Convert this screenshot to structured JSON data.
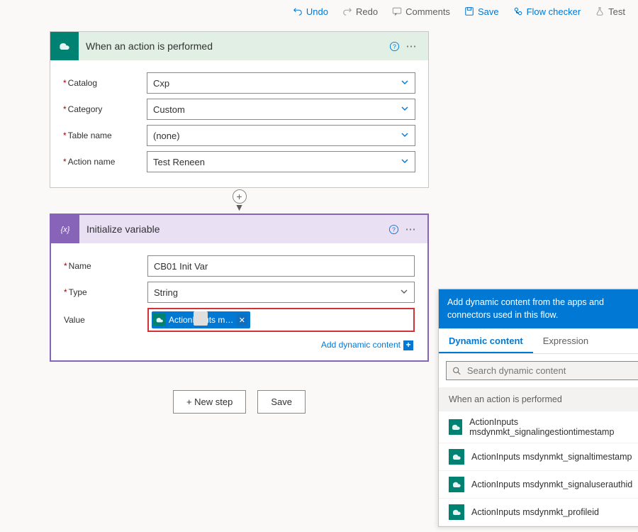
{
  "toolbar": {
    "undo": "Undo",
    "redo": "Redo",
    "comments": "Comments",
    "save": "Save",
    "flowchecker": "Flow checker",
    "test": "Test"
  },
  "card1": {
    "title": "When an action is performed",
    "fields": {
      "catalog": {
        "label": "Catalog",
        "value": "Cxp"
      },
      "category": {
        "label": "Category",
        "value": "Custom"
      },
      "tablename": {
        "label": "Table name",
        "value": "(none)"
      },
      "actionname": {
        "label": "Action name",
        "value": "Test Reneen"
      }
    }
  },
  "card2": {
    "title": "Initialize variable",
    "fields": {
      "name": {
        "label": "Name",
        "value": "CB01 Init Var"
      },
      "type": {
        "label": "Type",
        "value": "String"
      },
      "value": {
        "label": "Value",
        "token": "ActionInputs m…"
      }
    },
    "addDynamic": "Add dynamic content"
  },
  "buttons": {
    "newstep": "+ New step",
    "save": "Save"
  },
  "flyout": {
    "head": "Add dynamic content from the apps and connectors used in this flow.",
    "tab_dynamic": "Dynamic content",
    "tab_expression": "Expression",
    "search_placeholder": "Search dynamic content",
    "section": "When an action is performed",
    "items": [
      "ActionInputs msdynmkt_signalingestiontimestamp",
      "ActionInputs msdynmkt_signaltimestamp",
      "ActionInputs msdynmkt_signaluserauthid",
      "ActionInputs msdynmkt_profileid"
    ]
  }
}
